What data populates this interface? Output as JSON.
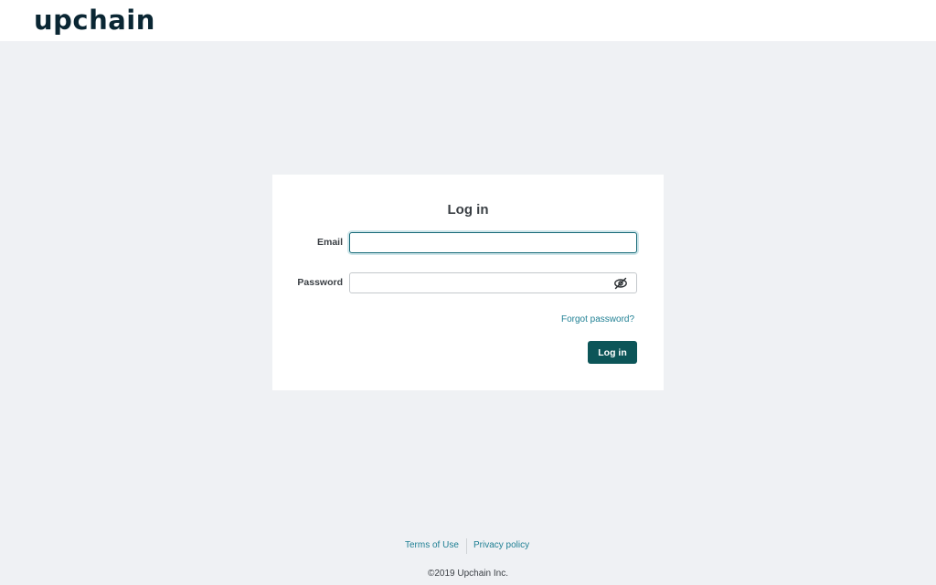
{
  "brand": {
    "logo_text": "upchain",
    "logo_color": "#0a2633"
  },
  "login": {
    "title": "Log in",
    "email_label": "Email",
    "email_value": "",
    "password_label": "Password",
    "password_value": "",
    "forgot_password": "Forgot password?",
    "submit_label": "Log in",
    "password_toggle_icon": "eye-off-icon"
  },
  "footer": {
    "terms": "Terms of Use",
    "privacy": "Privacy policy",
    "copyright": "©2019 Upchain Inc."
  },
  "colors": {
    "accent": "#0c5558",
    "link": "#1e7f93",
    "page_background": "#eff1f4"
  }
}
